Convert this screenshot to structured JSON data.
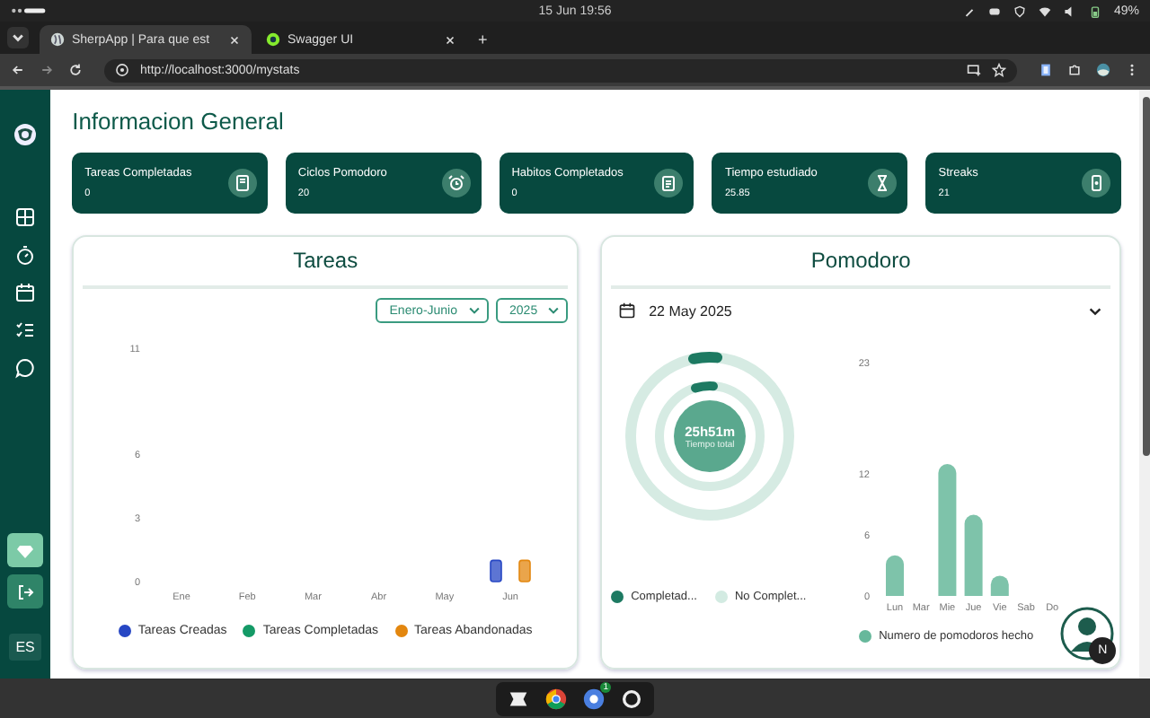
{
  "os_bar": {
    "clock": "15 Jun  19:56",
    "battery": "49%"
  },
  "browser": {
    "tabs": [
      {
        "title": "SherpApp | Para que est",
        "selected": true
      },
      {
        "title": "Swagger UI",
        "selected": false
      }
    ],
    "new_tab": "+",
    "url": "http://localhost:3000/mystats"
  },
  "sidebar": {
    "language": "ES"
  },
  "page_title": "Informacion General",
  "stats": [
    {
      "label": "Tareas Completadas",
      "value": "0"
    },
    {
      "label": "Ciclos Pomodoro",
      "value": "20"
    },
    {
      "label": "Habitos Completados",
      "value": "0"
    },
    {
      "label": "Tiempo estudiado",
      "value": "25.85"
    },
    {
      "label": "Streaks",
      "value": "21"
    }
  ],
  "tasks_panel": {
    "title": "Tareas",
    "period": "Enero-Junio",
    "year": "2025",
    "chart_data": {
      "type": "bar",
      "categories": [
        "Ene",
        "Feb",
        "Mar",
        "Abr",
        "May",
        "Jun"
      ],
      "series": [
        {
          "name": "Tareas Creadas",
          "color": "#2747c4",
          "values": [
            0,
            0,
            0,
            0,
            0,
            1
          ]
        },
        {
          "name": "Tareas Completadas",
          "color": "#149a66",
          "values": [
            0,
            0,
            0,
            0,
            0,
            0
          ]
        },
        {
          "name": "Tareas Abandonadas",
          "color": "#e3870f",
          "values": [
            0,
            0,
            0,
            0,
            0,
            1
          ]
        }
      ],
      "ylim": [
        0,
        11
      ],
      "yticks": [
        0,
        3,
        6,
        11
      ]
    }
  },
  "pomodoro_panel": {
    "title": "Pomodoro",
    "date": "22 May 2025",
    "total_time": "25h51m",
    "total_label": "Tiempo total",
    "ring_legend": [
      {
        "label": "Completad...",
        "color": "#1d7a62"
      },
      {
        "label": "No Complet...",
        "color": "#d3ebe2"
      }
    ],
    "chart_data": {
      "type": "bar",
      "categories": [
        "Lun",
        "Mar",
        "Mie",
        "Jue",
        "Vie",
        "Sab",
        "Do"
      ],
      "series": [
        {
          "name": "Numero de pomodoros hecho",
          "color": "#67b89b",
          "values": [
            4,
            0,
            13,
            8,
            2,
            0,
            0
          ]
        }
      ],
      "ylim": [
        0,
        23
      ],
      "yticks": [
        0,
        6,
        12,
        23
      ]
    }
  },
  "help_button": "N",
  "taskbar": {
    "badge": "1"
  }
}
